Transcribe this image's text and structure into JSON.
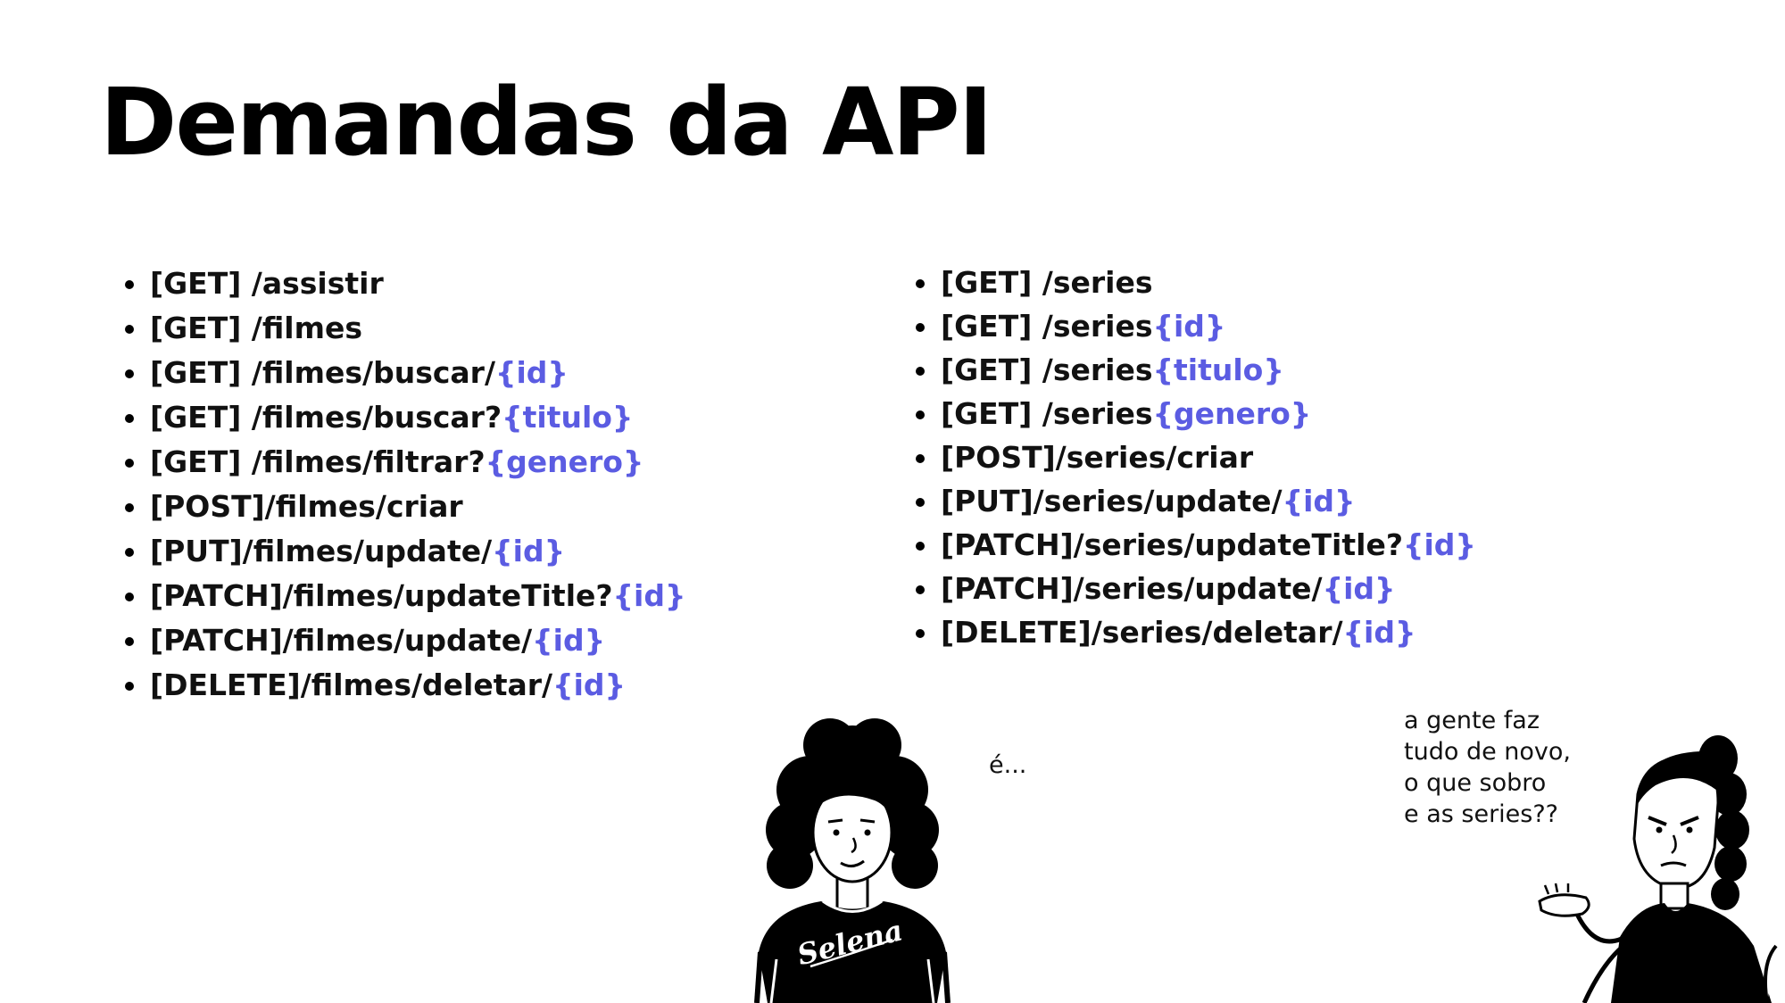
{
  "title": "Demandas da API",
  "colors": {
    "param": "#5b5ce2",
    "text": "#111111"
  },
  "left_endpoints": [
    {
      "text": "[GET] /assistir",
      "param": ""
    },
    {
      "text": "[GET] /filmes",
      "param": ""
    },
    {
      "text": "[GET] /filmes/buscar/",
      "param": "{id}"
    },
    {
      "text": "[GET] /filmes/buscar?",
      "param": "{titulo}"
    },
    {
      "text": "[GET] /filmes/filtrar?",
      "param": "{genero}"
    },
    {
      "text": "[POST]/filmes/criar",
      "param": ""
    },
    {
      "text": "[PUT]/filmes/update/",
      "param": "{id}"
    },
    {
      "text": "[PATCH]/filmes/updateTitle?",
      "param": "{id}"
    },
    {
      "text": "[PATCH]/filmes/update/",
      "param": "{id}"
    },
    {
      "text": "[DELETE]/filmes/deletar/",
      "param": "{id}"
    }
  ],
  "right_endpoints": [
    {
      "text": "[GET] /series",
      "param": ""
    },
    {
      "text": "[GET] /series",
      "param": "{id}"
    },
    {
      "text": "[GET] /series",
      "param": "{titulo}"
    },
    {
      "text": "[GET] /series",
      "param": "{genero}"
    },
    {
      "text": "[POST]/series/criar",
      "param": ""
    },
    {
      "text": "[PUT]/series/update/",
      "param": "{id}"
    },
    {
      "text": "[PATCH]/series/updateTitle?",
      "param": "{id}"
    },
    {
      "text": "[PATCH]/series/update/",
      "param": "{id}"
    },
    {
      "text": "[DELETE]/series/deletar/",
      "param": "{id}"
    }
  ],
  "speech": {
    "left": "é...",
    "right_lines": [
      "a gente faz",
      "tudo de novo,",
      "o que sobro",
      "e as series??"
    ]
  },
  "illustrations": {
    "left_figure": {
      "shirt_text": "Selena",
      "icon": "woman-curly-hair-illustration"
    },
    "right_figure": {
      "icon": "woman-shrugging-illustration"
    }
  }
}
